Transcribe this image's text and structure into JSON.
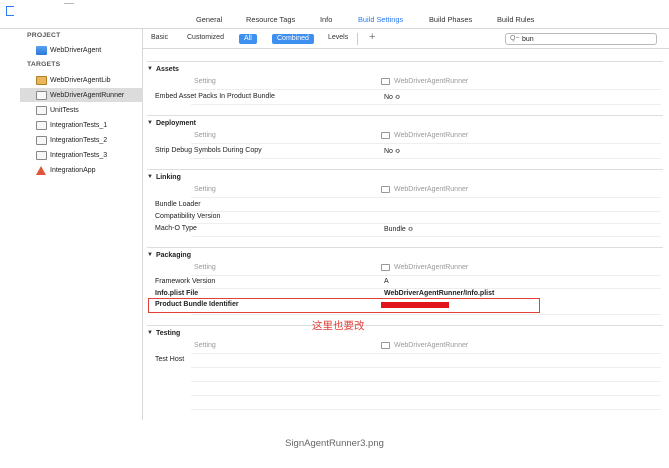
{
  "tabs": [
    {
      "label": "General",
      "active": false
    },
    {
      "label": "Resource Tags",
      "active": false
    },
    {
      "label": "Info",
      "active": false
    },
    {
      "label": "Build Settings",
      "active": true
    },
    {
      "label": "Build Phases",
      "active": false
    },
    {
      "label": "Build Rules",
      "active": false
    }
  ],
  "sidebar": {
    "project_heading": "PROJECT",
    "project_item": "WebDriverAgent",
    "targets_heading": "TARGETS",
    "targets": [
      {
        "label": "WebDriverAgentLib",
        "icon": "framework-icon"
      },
      {
        "label": "WebDriverAgentRunner",
        "icon": "test-bundle-icon",
        "selected": true
      },
      {
        "label": "UnitTests",
        "icon": "test-bundle-icon"
      },
      {
        "label": "IntegrationTests_1",
        "icon": "test-bundle-icon"
      },
      {
        "label": "IntegrationTests_2",
        "icon": "test-bundle-icon"
      },
      {
        "label": "IntegrationTests_3",
        "icon": "test-bundle-icon"
      },
      {
        "label": "IntegrationApp",
        "icon": "app-icon"
      }
    ]
  },
  "filterbar": {
    "basic": "Basic",
    "customized": "Customized",
    "all": "All",
    "combined": "Combined",
    "levels": "Levels",
    "add": "+",
    "search_value": "bun",
    "search_icon": "Q~"
  },
  "column": {
    "setting": "Setting",
    "target": "WebDriverAgentRunner"
  },
  "sections": [
    {
      "title": "Assets",
      "rows": [
        {
          "label": "Embed Asset Packs In Product Bundle",
          "value": "No ≎"
        }
      ]
    },
    {
      "title": "Deployment",
      "rows": [
        {
          "label": "Strip Debug Symbols During Copy",
          "value": "No ≎"
        }
      ]
    },
    {
      "title": "Linking",
      "rows": [
        {
          "label": "Bundle Loader",
          "value": ""
        },
        {
          "label": "Compatibility Version",
          "value": ""
        },
        {
          "label": "Mach-O Type",
          "value": "Bundle ≎"
        }
      ]
    },
    {
      "title": "Packaging",
      "rows": [
        {
          "label": "Framework Version",
          "value": "A"
        },
        {
          "label": "Info.plist File",
          "value": "WebDriverAgentRunner/Info.plist",
          "bold": true
        },
        {
          "label": "Product Bundle Identifier",
          "value": "",
          "bold": true,
          "redacted": true
        }
      ]
    },
    {
      "title": "Testing",
      "rows": [
        {
          "label": "Test Host",
          "value": ""
        }
      ]
    }
  ],
  "annotation": "这里也要改",
  "caption": "SignAgentRunner3.png",
  "colors": {
    "accent": "#2b7cf6",
    "highlight": "#e3403a",
    "redact": "#e0141a"
  }
}
